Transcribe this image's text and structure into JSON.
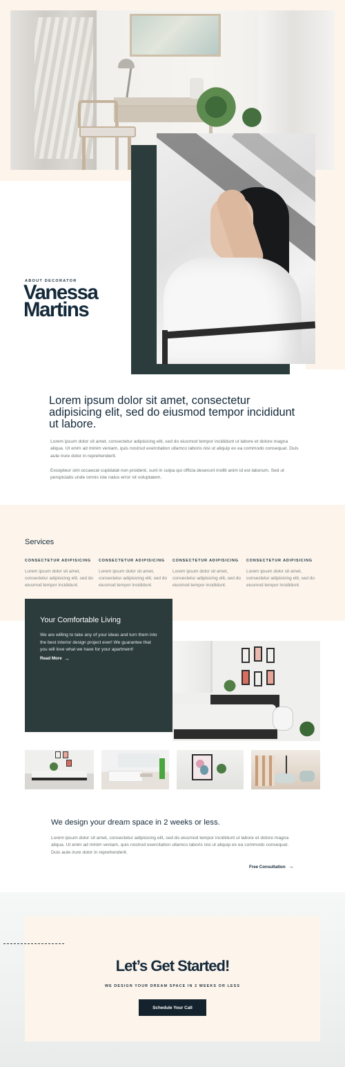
{
  "about": {
    "eyebrow": "ABOUT DECORATOR",
    "name_line1": "Vanessa",
    "name_line2": "Martins"
  },
  "intro": {
    "title": "Lorem ipsum dolor sit amet, consectetur adipisicing elit, sed do eiusmod tempor incididunt ut labore.",
    "paragraph1": "Lorem ipsum dolor sit amet, consectetur adipisicing elit, sed do eiusmod tempor incididunt ut labore et dolore magna aliqua. Ut enim ad minim veniam, quis nostrud exercitation ullamco laboris nisi ut aliquip ex ea commodo consequat. Duis aute irure dolor in reprehenderit.",
    "paragraph2": "Excepteur sint occaecat cupidatat non proident, sunt in culpa qui officia deserunt mollit anim id est laborum. Sed ut perspiciatis unde omnis iste natus error sit voluptatem."
  },
  "services": {
    "title": "Services",
    "items": [
      {
        "heading": "CONSECTETUR ADIPISICING",
        "text": "Lorem ipsum dolor sit amet, consectetur adipisicing elit, sed do eiusmod tempor incididunt."
      },
      {
        "heading": "CONSECTETUR ADIPISICING",
        "text": "Lorem ipsum dolor sit amet, consectetur adipisicing elit, sed do eiusmod tempor incididunt."
      },
      {
        "heading": "CONSECTETUR ADIPISICING",
        "text": "Lorem ipsum dolor sit amet, consectetur adipisicing elit, sed do eiusmod tempor incididunt."
      },
      {
        "heading": "CONSECTETUR ADIPISICING",
        "text": "Lorem ipsum dolor sit amet, consectetur adipisicing elit, sed do eiusmod tempor incididunt."
      }
    ]
  },
  "living": {
    "title": "Your Comfortable Living",
    "text": "We are willing to take any of your ideas and turn them into the best interior design project ever! We guarantee that you will love what we have for your apartment!",
    "link_label": "Read More",
    "link_arrow": "→"
  },
  "design": {
    "title": "We design your dream space in 2 weeks or less.",
    "text": "Lorem ipsum dolor sit amet, consectetur adipisicing elit, sed do eiusmod tempor incididunt ut labore et dolore magna aliqua. Ut enim ad minim veniam, quis nostrud exercitation ullamco laboris nisi ut aliquip ex ea commodo consequat. Duis aute irure dolor in reprehenderit.",
    "link_label": "Free Consultation",
    "link_arrow": "→"
  },
  "cta": {
    "title": "Let’s Get Started!",
    "subtitle": "WE DESIGN YOUR DREAM SPACE IN 2 WEEKS OR LESS",
    "button_label": "Schedule Your Call"
  },
  "colors": {
    "cream": "#fdf5ec",
    "dark_teal": "#2c3b3c",
    "navy": "#13293a",
    "button": "#13222c"
  }
}
